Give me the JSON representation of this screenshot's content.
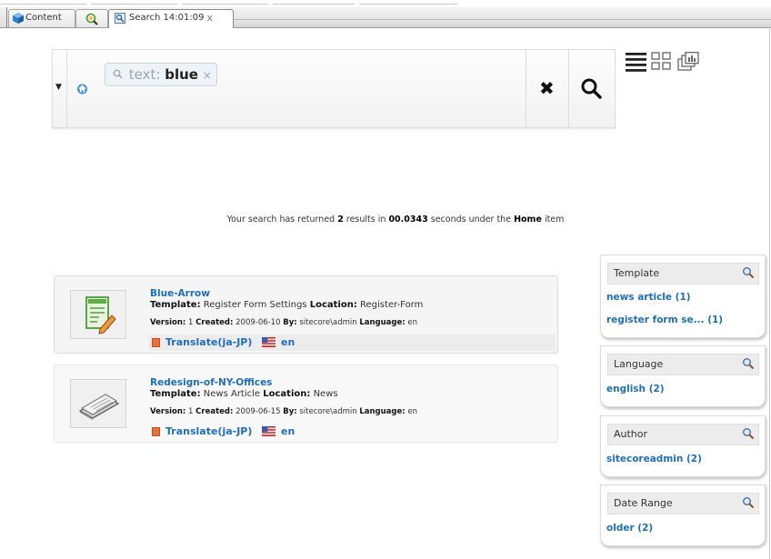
{
  "tabs": [
    {
      "label": "Content",
      "icon": "cube-icon"
    },
    {
      "label": "",
      "icon": "tools-icon"
    },
    {
      "label": "Search 14:01:09",
      "icon": "search-tab-icon",
      "close": "x"
    }
  ],
  "search": {
    "token_label": "text:",
    "token_value": "blue",
    "token_remove": "×",
    "clear_symbol": "✖"
  },
  "summary": {
    "prefix": "Your search has returned",
    "count": "2",
    "mid": "results in",
    "seconds": "00.0343",
    "mid2": "seconds under the",
    "item": "Home",
    "suffix": "item"
  },
  "results": [
    {
      "title": "Blue-Arrow",
      "template_label": "Template:",
      "template": "Register Form Settings",
      "location_label": "Location:",
      "location": "Register-Form",
      "version_label": "Version:",
      "version": "1",
      "created_label": "Created:",
      "created": "2009-06-10",
      "by_label": "By:",
      "by": "sitecore\\admin",
      "language_label": "Language:",
      "language": "en",
      "translate": "Translate(ja-JP)",
      "lang_link": "en",
      "thumb_icon": "form-document-icon"
    },
    {
      "title": "Redesign-of-NY-Offices",
      "template_label": "Template:",
      "template": "News Article",
      "location_label": "Location:",
      "location": "News",
      "version_label": "Version:",
      "version": "1",
      "created_label": "Created:",
      "created": "2009-06-15",
      "by_label": "By:",
      "by": "sitecore\\admin",
      "language_label": "Language:",
      "language": "en",
      "translate": "Translate(ja-JP)",
      "lang_link": "en",
      "thumb_icon": "newspaper-icon"
    }
  ],
  "facets": [
    {
      "title": "Template",
      "items": [
        "news article (1)",
        "register form se... (1)"
      ]
    },
    {
      "title": "Language",
      "items": [
        "english (2)"
      ]
    },
    {
      "title": "Author",
      "items": [
        "sitecoreadmin (2)"
      ]
    },
    {
      "title": "Date Range",
      "items": [
        "older (2)"
      ]
    }
  ],
  "colors": {
    "link": "#1e6fb8",
    "accent_orange": "#ea6e3c"
  }
}
